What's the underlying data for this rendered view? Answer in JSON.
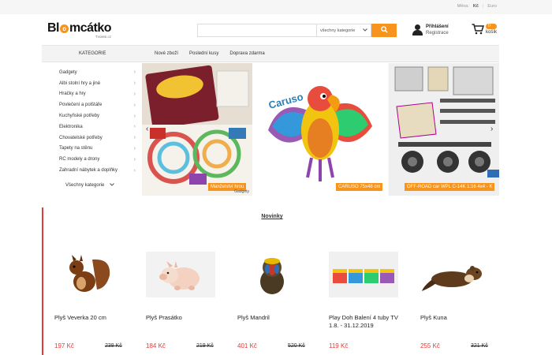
{
  "topbar": {
    "lang": "Měna:",
    "currency": "Kč",
    "sep": "|",
    "alt_currency": "Euro"
  },
  "header": {
    "logo_text_pre": "Bl",
    "logo_text_o": "o",
    "logo_text_post": "mcátko",
    "logo_sub": "Tvoiesi.cz",
    "search": {
      "placeholder": "",
      "category": "všechny kategorie"
    },
    "login": {
      "title": "Přihlášení",
      "register": "Registrace"
    },
    "cart": {
      "count": "0",
      "label": "košík"
    }
  },
  "nav": {
    "category_label": "KATEGORIE",
    "links": [
      "Nové zboží",
      "Poslední kusy",
      "Doprava zdarma"
    ]
  },
  "sidebar": {
    "items": [
      "Gadgety",
      "Albi stolní hry a jiné",
      "Hračky a hry",
      "Povlečení a polštáře",
      "Kuchyňské potřeby",
      "Elektronika",
      "Chovatelské potřeby",
      "Tapety na stěnu",
      "RC modely a drony",
      "Zahradní nábytek a doplňky"
    ],
    "all_label": "Všechny kategorie"
  },
  "banner": {
    "slides": [
      {
        "tag": "Manželství hrou",
        "caption": "Gadgety"
      },
      {
        "tag": "CARUSO 75x48 cm",
        "caption": ""
      },
      {
        "tag": "OFF-ROAD car WPL C-14K 1:16 4x4 - K",
        "caption": ""
      }
    ],
    "prev": "‹",
    "next": "›"
  },
  "products": {
    "title": "Novinky",
    "items": [
      {
        "name": "Plyš Veverka 20 cm",
        "price": "197 Kč",
        "old": "238 Kč"
      },
      {
        "name": "Plyš Prasátko",
        "price": "184 Kč",
        "old": "219 Kč"
      },
      {
        "name": "Plyš Mandril",
        "price": "401 Kč",
        "old": "520 Kč"
      },
      {
        "name": "Play Doh Balení 4 tuby TV 1.8. - 31.12.2019",
        "price": "119 Kč",
        "old": ""
      },
      {
        "name": "Plyš Kuna",
        "price": "255 Kč",
        "old": "321 Kč"
      }
    ]
  },
  "colors": {
    "accent": "#f7941d",
    "price": "#e53935"
  }
}
